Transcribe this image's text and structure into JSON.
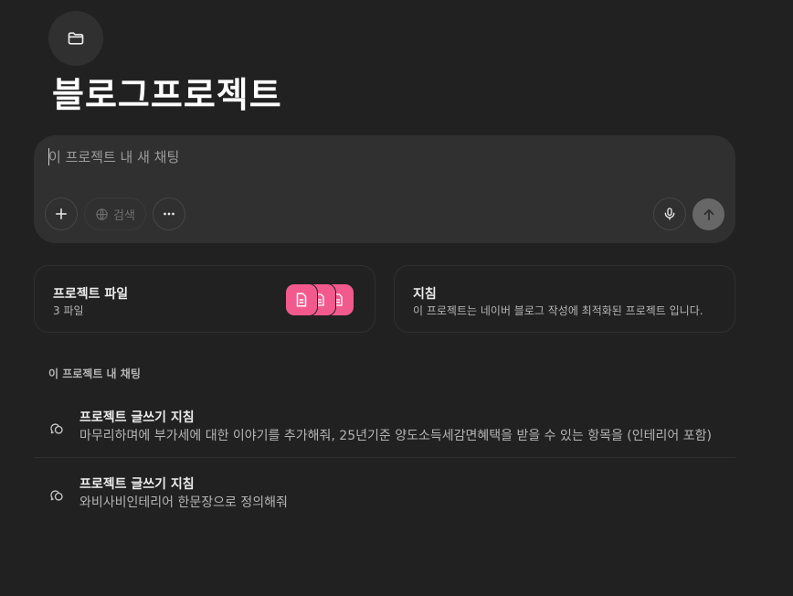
{
  "project": {
    "title": "블로그프로젝트"
  },
  "composer": {
    "placeholder": "이 프로젝트 내 새 채팅",
    "search_label": "검색"
  },
  "cards": {
    "files": {
      "title": "프로젝트 파일",
      "subtitle": "3 파일"
    },
    "guide": {
      "title": "지침",
      "subtitle": "이 프로젝트는 네이버 블로그 작성에 최적화된 프로젝트 입니다."
    }
  },
  "chats": {
    "section_label": "이 프로젝트 내 채팅",
    "items": [
      {
        "title": "프로젝트 글쓰기 지침",
        "snippet": "마무리하며에 부가세에 대한 이야기를 추가해줘, 25년기준 양도소득세감면혜택을 받을 수 있는 항목을 (인테리어 포함)"
      },
      {
        "title": "프로젝트 글쓰기 지침",
        "snippet": "와비사비인테리어 한문장으로 정의해줘"
      }
    ]
  },
  "colors": {
    "background": "#212121",
    "surface": "#303030",
    "file_accent": "#f25a8d",
    "send_button": "#676767"
  },
  "icons": {
    "folder": "folder-icon",
    "plus": "plus-icon",
    "globe": "globe-icon",
    "more": "more-icon",
    "mic": "microphone-icon",
    "send": "arrow-up-icon",
    "file": "document-icon",
    "chat": "chat-bubbles-icon"
  }
}
